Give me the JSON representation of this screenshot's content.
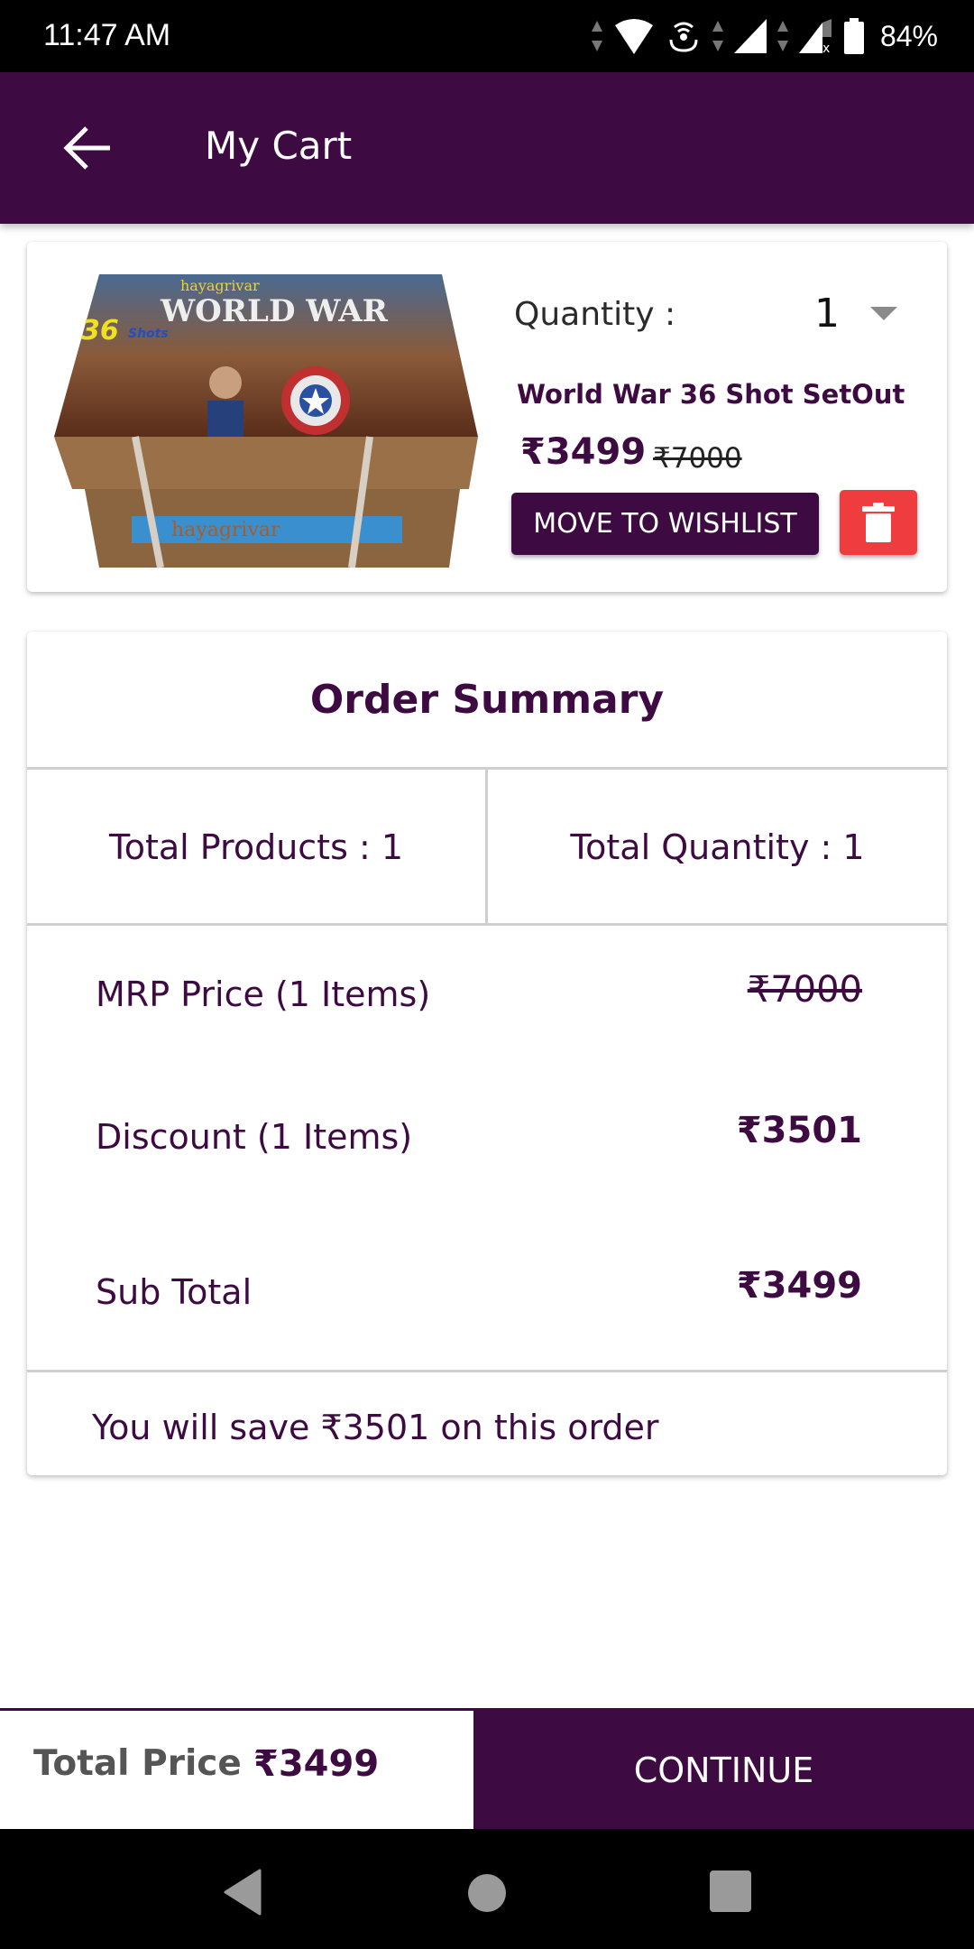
{
  "status_bar": {
    "time": "11:47 AM",
    "battery_percent": "84%",
    "icons": [
      "data-arrows-icon",
      "wifi-icon",
      "hotspot-icon",
      "data-arrows-icon",
      "signal-icon",
      "data-arrows-icon",
      "signal-no-sim-icon",
      "battery-icon"
    ]
  },
  "app_bar": {
    "back_icon": "arrow-left-icon",
    "title": "My Cart"
  },
  "cart_items": [
    {
      "image_alt": "World War 36 Shots firework box (hayagrivar)",
      "image_texts": [
        "hayagrivar",
        "WORLD WAR",
        "36",
        "Shots"
      ],
      "quantity_label": "Quantity :",
      "quantity_value": "1",
      "name": "World War 36 Shot SetOut",
      "price": "₹3499",
      "mrp": "₹7000",
      "wishlist_label": "MOVE TO WISHLIST",
      "delete_icon": "trash-icon"
    }
  ],
  "order_summary": {
    "title": "Order Summary",
    "total_products": "Total Products : 1",
    "total_quantity": "Total Quantity : 1",
    "rows": [
      {
        "label": "MRP Price (1 Items)",
        "value": "₹7000",
        "strike": true
      },
      {
        "label": "Discount (1 Items)",
        "value": "₹3501",
        "strike": false
      },
      {
        "label": "Sub Total",
        "value": "₹3499",
        "strike": false
      }
    ],
    "savings_text": "You will save ₹3501 on this order"
  },
  "bottom_bar": {
    "total_label": "Total Price",
    "total_value": "₹3499",
    "continue_label": "CONTINUE"
  },
  "colors": {
    "brand_purple": "#3d0b42",
    "delete_red": "#ef3d3f",
    "divider": "#cfcfcf"
  },
  "nav_bar": {
    "buttons": [
      "nav-back-icon",
      "nav-home-icon",
      "nav-recents-icon"
    ]
  }
}
